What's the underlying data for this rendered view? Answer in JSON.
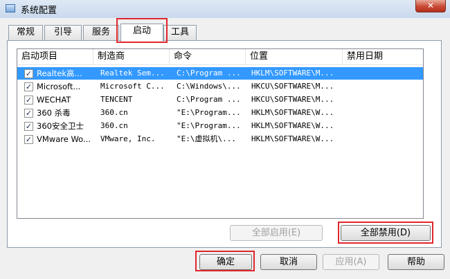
{
  "window": {
    "title": "系统配置",
    "close_glyph": "✕"
  },
  "tabs": [
    {
      "label": "常规"
    },
    {
      "label": "引导"
    },
    {
      "label": "服务"
    },
    {
      "label": "启动",
      "active": true
    },
    {
      "label": "工具"
    }
  ],
  "startup_list": {
    "columns": [
      "启动项目",
      "制造商",
      "命令",
      "位置",
      "禁用日期"
    ],
    "rows": [
      {
        "checked": true,
        "selected": true,
        "item": "Realtek高...",
        "maker": "Realtek Sem...",
        "command": "C:\\Program ...",
        "location": "HKLM\\SOFTWARE\\M...",
        "disabled_date": ""
      },
      {
        "checked": true,
        "selected": false,
        "item": "Microsoft...",
        "maker": "Microsoft C...",
        "command": "C:\\Windows\\...",
        "location": "HKCU\\SOFTWARE\\M...",
        "disabled_date": ""
      },
      {
        "checked": true,
        "selected": false,
        "item": "WECHAT",
        "maker": "TENCENT",
        "command": "C:\\Program ...",
        "location": "HKCU\\SOFTWARE\\M...",
        "disabled_date": ""
      },
      {
        "checked": true,
        "selected": false,
        "item": "360 杀毒",
        "maker": "360.cn",
        "command": "\"E:\\Program...",
        "location": "HKLM\\SOFTWARE\\W...",
        "disabled_date": ""
      },
      {
        "checked": true,
        "selected": false,
        "item": "360安全卫士",
        "maker": "360.cn",
        "command": "\"E:\\Program...",
        "location": "HKLM\\SOFTWARE\\W...",
        "disabled_date": ""
      },
      {
        "checked": true,
        "selected": false,
        "item": "VMware Wo...",
        "maker": "VMware, Inc.",
        "command": "\"E:\\虚拟机\\...",
        "location": "HKLM\\SOFTWARE\\W...",
        "disabled_date": ""
      }
    ]
  },
  "buttons": {
    "enable_all": "全部启用(E)",
    "disable_all": "全部禁用(D)",
    "ok": "确定",
    "cancel": "取消",
    "apply": "应用(A)",
    "help": "帮助"
  },
  "colors": {
    "selection": "#3399ff",
    "highlight_box": "#e0262b"
  }
}
